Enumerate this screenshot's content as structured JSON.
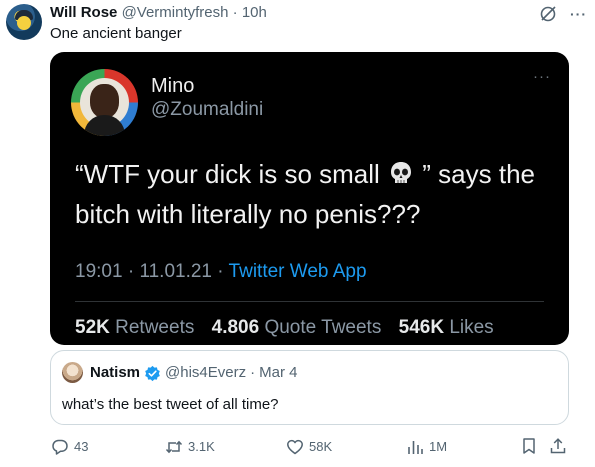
{
  "tweet": {
    "author_name": "Will Rose",
    "author_handle": "@Vermintyfresh",
    "separator": "·",
    "time": "10h",
    "text": "One ancient banger"
  },
  "media": {
    "name": "Mino",
    "handle": "@Zoumaldini",
    "text_before": "“WTF your dick is so small",
    "text_after": " ” says the bitch with literally no penis???",
    "time": "19:01",
    "dot1": "·",
    "date": "11.01.21",
    "dot2": "·",
    "app": "Twitter Web App",
    "retweets_count": "52K",
    "retweets_label": "Retweets",
    "quotes_count": "4.806",
    "quotes_label": "Quote Tweets",
    "likes_count": "546K",
    "likes_label": "Likes"
  },
  "quote": {
    "name": "Natism",
    "handle": "@his4Everz",
    "separator": "·",
    "date": "Mar 4",
    "text": "what’s the best tweet of all time?"
  },
  "actions": {
    "replies": "43",
    "retweets": "3.1K",
    "likes": "58K",
    "views": "1M"
  },
  "colors": {
    "accent": "#1d9bf0",
    "muted": "#536471",
    "text": "#0f1419"
  }
}
